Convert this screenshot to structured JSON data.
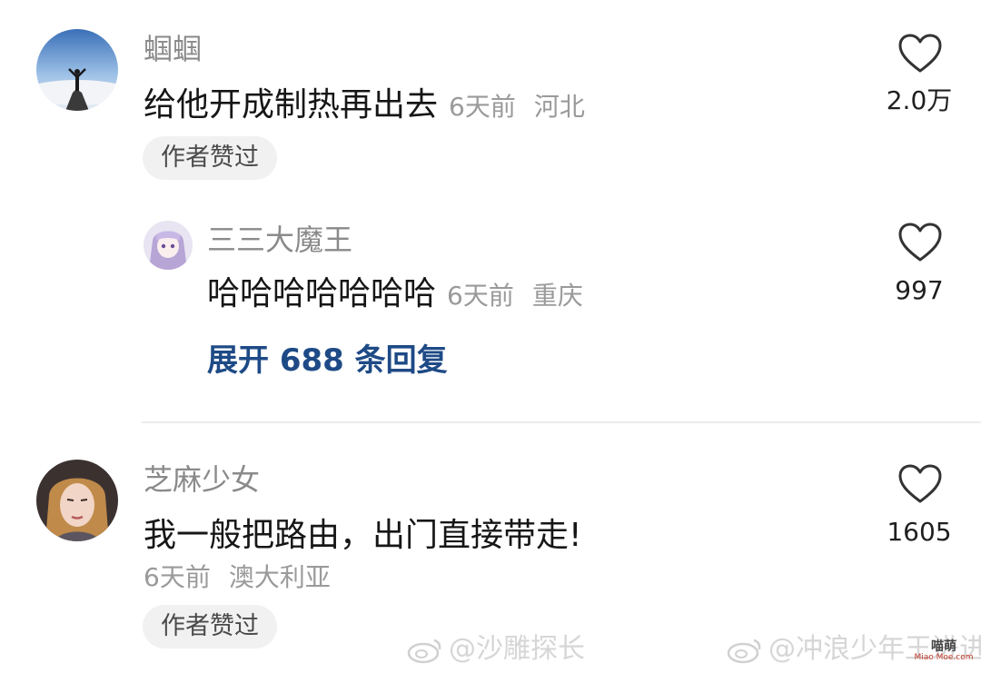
{
  "comments": [
    {
      "username": "蝈蝈",
      "text": "给他开成制热再出去",
      "time": "6天前",
      "location": "河北",
      "author_badge": "作者赞过",
      "likes": "2.0万"
    },
    {
      "username": "芝麻少女",
      "text": "我一般把路由，出门直接带走!",
      "time": "6天前",
      "location": "澳大利亚",
      "author_badge": "作者赞过",
      "likes": "1605"
    }
  ],
  "reply": {
    "username": "三三大魔王",
    "text": "哈哈哈哈哈哈哈",
    "time": "6天前",
    "location": "重庆",
    "likes": "997"
  },
  "expand_replies": "展开 688 条回复",
  "watermarks": {
    "left": "@沙雕探长",
    "right": "@冲浪少年王进进"
  },
  "corner_badge": {
    "line1": "喵萌",
    "line2": "Miao Moe.com"
  },
  "colors": {
    "accent_blue": "#1e4a86",
    "meta_gray": "#9a9a9a",
    "pill_bg": "#f1f1f1"
  }
}
